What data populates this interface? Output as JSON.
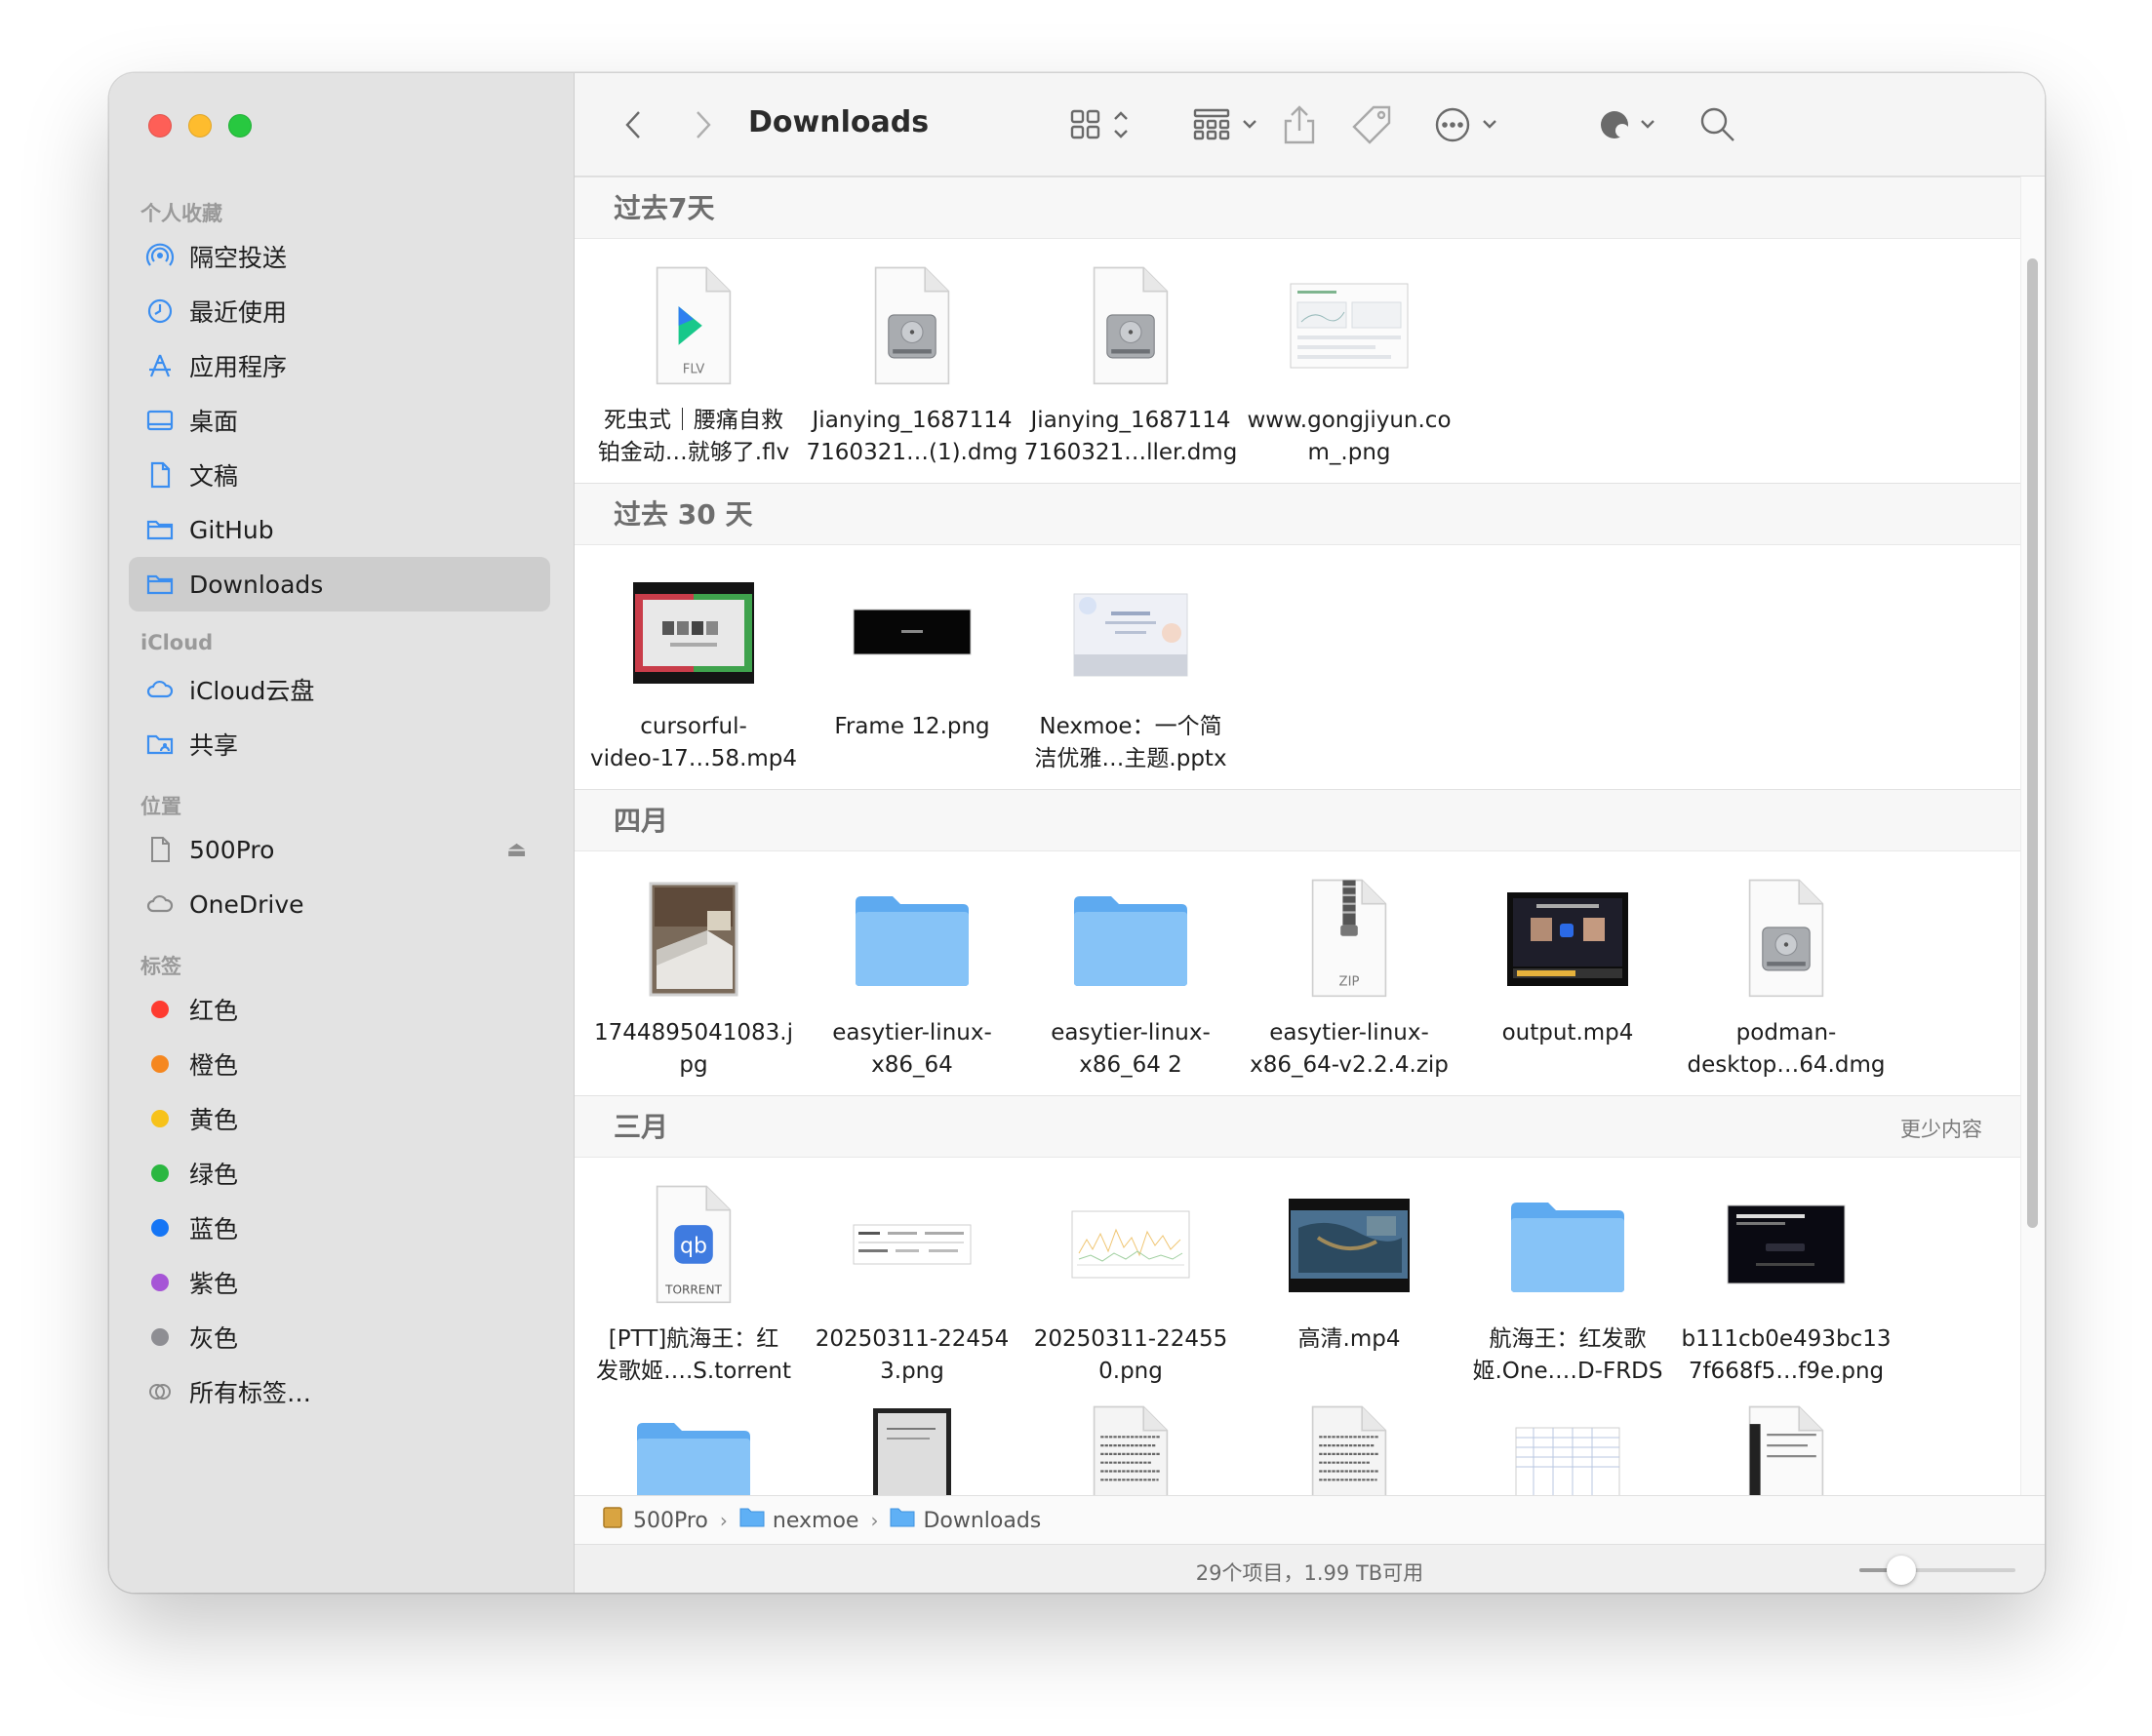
{
  "window": {
    "title": "Downloads"
  },
  "sidebar": {
    "favorites_title": "个人收藏",
    "favorites": [
      {
        "label": "隔空投送",
        "icon": "airdrop-icon"
      },
      {
        "label": "最近使用",
        "icon": "clock-icon"
      },
      {
        "label": "应用程序",
        "icon": "apps-icon"
      },
      {
        "label": "桌面",
        "icon": "desktop-icon"
      },
      {
        "label": "文稿",
        "icon": "document-icon"
      },
      {
        "label": "GitHub",
        "icon": "folder-icon"
      },
      {
        "label": "Downloads",
        "icon": "folder-icon",
        "selected": true
      }
    ],
    "icloud_title": "iCloud",
    "icloud": [
      {
        "label": "iCloud云盘",
        "icon": "cloud-icon"
      },
      {
        "label": "共享",
        "icon": "shared-folder-icon"
      }
    ],
    "locations_title": "位置",
    "locations": [
      {
        "label": "500Pro",
        "icon": "disk-icon",
        "eject": "⏏"
      },
      {
        "label": "OneDrive",
        "icon": "cloud-icon"
      }
    ],
    "tags_title": "标签",
    "tags": [
      {
        "label": "红色",
        "color": "#fe3b30"
      },
      {
        "label": "橙色",
        "color": "#f5871f"
      },
      {
        "label": "黄色",
        "color": "#f7c21a"
      },
      {
        "label": "绿色",
        "color": "#2bb741"
      },
      {
        "label": "蓝色",
        "color": "#1575f5"
      },
      {
        "label": "紫色",
        "color": "#a655d6"
      },
      {
        "label": "灰色",
        "color": "#8e8e93"
      },
      {
        "label": "所有标签…",
        "color": "",
        "icon": "all-tags-icon"
      }
    ]
  },
  "groups": [
    {
      "title": "过去7天",
      "more": "",
      "files": [
        {
          "name": "死虫式｜腰痛自救\n铂金动…就够了.flv",
          "kind": "flv",
          "badge": "FLV"
        },
        {
          "name": "Jianying_1687114\n7160321…(1).dmg",
          "kind": "dmg"
        },
        {
          "name": "Jianying_1687114\n7160321…ller.dmg",
          "kind": "dmg"
        },
        {
          "name": "www.gongjiyun.co\nm_.png",
          "kind": "web-screenshot"
        }
      ]
    },
    {
      "title": "过去 30 天",
      "more": "",
      "files": [
        {
          "name": "cursorful-\nvideo-17…58.mp4",
          "kind": "video-desktop"
        },
        {
          "name": "Frame 12.png",
          "kind": "dark-banner"
        },
        {
          "name": "Nexmoe：一个简\n洁优雅…主题.pptx",
          "kind": "pptx"
        }
      ]
    },
    {
      "title": "四月",
      "more": "",
      "files": [
        {
          "name": "1744895041083.j\npg",
          "kind": "photo"
        },
        {
          "name": "easytier-linux-\nx86_64",
          "kind": "folder"
        },
        {
          "name": "easytier-linux-\nx86_64 2",
          "kind": "folder"
        },
        {
          "name": "easytier-linux-\nx86_64-v2.2.4.zip",
          "kind": "zip",
          "badge": "ZIP"
        },
        {
          "name": "output.mp4",
          "kind": "video-people"
        },
        {
          "name": "podman-\ndesktop…64.dmg",
          "kind": "dmg"
        }
      ]
    },
    {
      "title": "三月",
      "more": "更少内容",
      "files": [
        {
          "name": "[PTT]航海王：红\n发歌姬….S.torrent",
          "kind": "torrent",
          "badge": "TORRENT",
          "mark": "qb"
        },
        {
          "name": "20250311-22454\n3.png",
          "kind": "table-screenshot"
        },
        {
          "name": "20250311-22455\n0.png",
          "kind": "chart-screenshot"
        },
        {
          "name": "高清.mp4",
          "kind": "video-map"
        },
        {
          "name": "航海王：红发歌\n姬.One.…D-FRDS",
          "kind": "folder"
        },
        {
          "name": "b111cb0e493bc13\n7f668f5…f9e.png",
          "kind": "dark-page"
        }
      ]
    }
  ],
  "partial_row": [
    "folder",
    "scan",
    "text-doc",
    "text-doc",
    "spreadsheet",
    "dark-doc"
  ],
  "pathbar": [
    {
      "label": "500Pro",
      "icon": "disk-icon"
    },
    {
      "label": "nexmoe",
      "icon": "folder-icon"
    },
    {
      "label": "Downloads",
      "icon": "folder-icon"
    }
  ],
  "pathbar_separator": "›",
  "status": {
    "text": "29个项目，1.99 TB可用",
    "zoom": 0.27
  }
}
